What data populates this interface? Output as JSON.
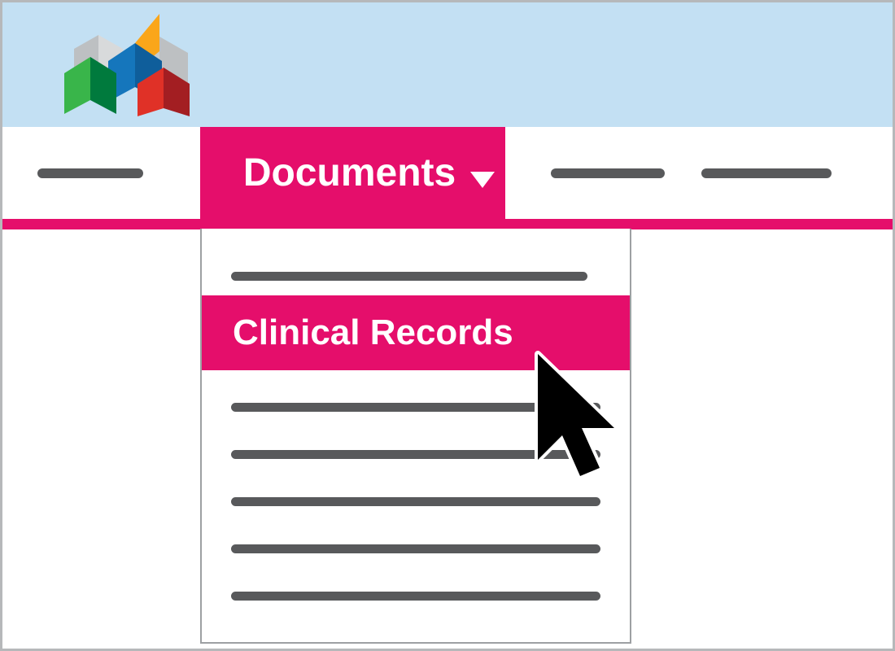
{
  "colors": {
    "accent": "#e50e6b",
    "banner": "#c3e0f3",
    "line": "#58595b",
    "border": "#b6b8ba"
  },
  "nav": {
    "active_label": "Documents"
  },
  "dropdown": {
    "highlight_label": "Clinical Records"
  }
}
